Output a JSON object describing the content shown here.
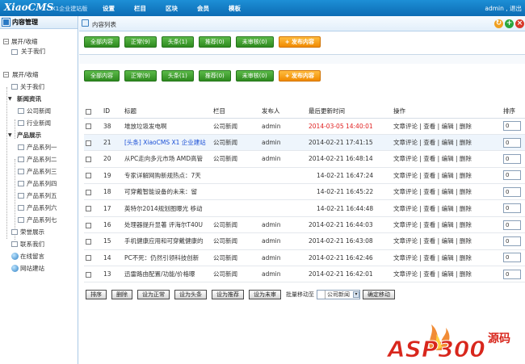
{
  "app": {
    "logo": "XiaoCMS",
    "subtitle": "X1企业建站版",
    "nav": [
      "设置",
      "栏目",
      "区块",
      "会员",
      "模板"
    ],
    "user": "admin , 退出"
  },
  "sidebar": {
    "title": "内容管理",
    "top": [
      "展开/收缩",
      "关于我们"
    ],
    "tree": [
      {
        "label": "展开/收缩",
        "icon": "expand"
      },
      {
        "label": "关于我们",
        "icon": "doc"
      },
      {
        "label": "新闻资讯",
        "icon": "folder"
      },
      {
        "label": "公司新闻",
        "icon": "doc"
      },
      {
        "label": "行业新闻",
        "icon": "doc"
      },
      {
        "label": "产品展示",
        "icon": "folder"
      },
      {
        "label": "产品系列一",
        "icon": "doc"
      },
      {
        "label": "产品系列二",
        "icon": "doc"
      },
      {
        "label": "产品系列三",
        "icon": "doc"
      },
      {
        "label": "产品系列四",
        "icon": "doc"
      },
      {
        "label": "产品系列五",
        "icon": "doc"
      },
      {
        "label": "产品系列六",
        "icon": "doc"
      },
      {
        "label": "产品系列七",
        "icon": "doc"
      },
      {
        "label": "荣誉展示",
        "icon": "doc"
      },
      {
        "label": "联系我们",
        "icon": "doc"
      },
      {
        "label": "在线留言",
        "icon": "globe"
      },
      {
        "label": "网站建站",
        "icon": "globe"
      }
    ]
  },
  "main": {
    "title": "内容列表",
    "filters": [
      "全部内容",
      "正常(9)",
      "头条(1)",
      "推荐(0)",
      "未审核(0)"
    ],
    "publish": "+ 发布内容",
    "columns": [
      "ID",
      "标题",
      "栏目",
      "发布人",
      "最后更新时间",
      "操作",
      "排序"
    ],
    "rows": [
      {
        "id": "38",
        "title": "堆放垃圾发电啊",
        "cat": "公司新闻",
        "author": "admin",
        "time": "2014-03-05 14:40:01",
        "red": true,
        "order": "0"
      },
      {
        "id": "21",
        "title": "[头条] XiaoCMS X1 企业建站",
        "cat": "公司新闻",
        "author": "admin",
        "time": "2014-02-21 17:41:15",
        "hl": true,
        "order": "0"
      },
      {
        "id": "20",
        "title": "从PC走向多元市场 AMD高管",
        "cat": "公司新闻",
        "author": "admin",
        "time": "2014-02-21 16:48:14",
        "order": "0"
      },
      {
        "id": "19",
        "title": "专家详解网购新规热点：7天",
        "cat": "",
        "author": "",
        "time": "14-02-21 16:47:24",
        "order": "0"
      },
      {
        "id": "18",
        "title": "可穿戴智能设备的未来：留",
        "cat": "",
        "author": "",
        "time": "14-02-21 16:45:22",
        "order": "0"
      },
      {
        "id": "17",
        "title": "英特尔2014规划图曝光 移动",
        "cat": "",
        "author": "",
        "time": "14-02-21 16:44:48",
        "order": "0"
      },
      {
        "id": "16",
        "title": "处理器提升显著 评海尔T40U",
        "cat": "公司新闻",
        "author": "admin",
        "time": "2014-02-21 16:44:03",
        "order": "0"
      },
      {
        "id": "15",
        "title": "手机健康应用和可穿戴健康的",
        "cat": "公司新闻",
        "author": "admin",
        "time": "2014-02-21 16:43:08",
        "order": "0"
      },
      {
        "id": "14",
        "title": "PC不死：仍然引领科技创新",
        "cat": "公司新闻",
        "author": "admin",
        "time": "2014-02-21 16:42:46",
        "order": "0"
      },
      {
        "id": "13",
        "title": "迅雷路由配置/功能/价格曝",
        "cat": "公司新闻",
        "author": "admin",
        "time": "2014-02-21 16:42:01",
        "order": "0"
      }
    ],
    "ops": [
      "文章评论",
      "查看",
      "编辑",
      "删除"
    ],
    "bottom": {
      "buttons": [
        "排序",
        "删除",
        "设为正常",
        "设为头条",
        "设为推荐",
        "设为未审"
      ],
      "move_label": "批量移动至",
      "select_value": "公司新闻",
      "confirm": "确定移动"
    }
  },
  "watermark": {
    "text": "ASP300",
    "suffix": "源码"
  }
}
